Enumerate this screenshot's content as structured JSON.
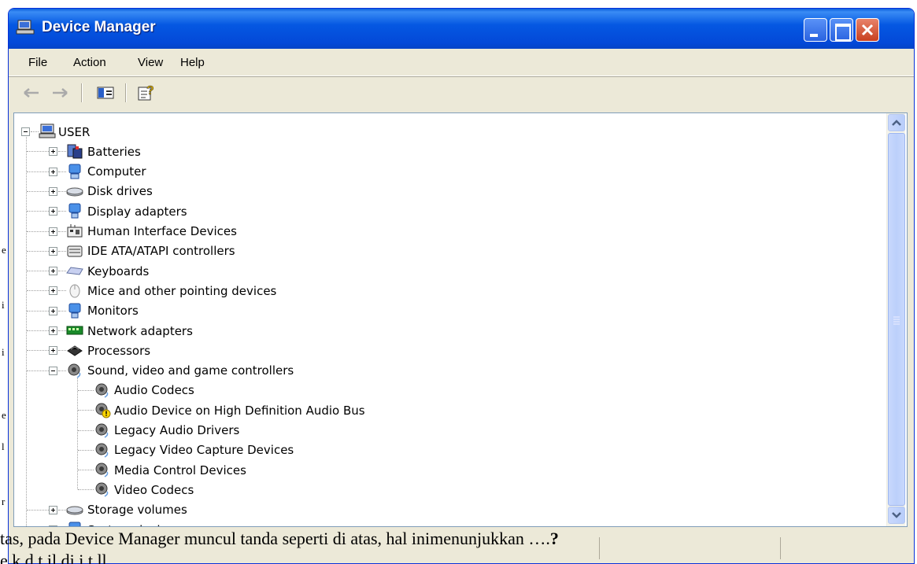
{
  "window": {
    "title": "Device Manager"
  },
  "menu": {
    "file": "File",
    "action": "Action",
    "view": "View",
    "help": "Help"
  },
  "tree": {
    "root": "USER",
    "categories": [
      {
        "label": "Batteries",
        "icon": "battery-icon",
        "expanded": false
      },
      {
        "label": "Computer",
        "icon": "computer-icon",
        "expanded": false
      },
      {
        "label": "Disk drives",
        "icon": "disk-drive-icon",
        "expanded": false
      },
      {
        "label": "Display adapters",
        "icon": "display-adapter-icon",
        "expanded": false
      },
      {
        "label": "Human Interface Devices",
        "icon": "hid-icon",
        "expanded": false
      },
      {
        "label": "IDE ATA/ATAPI controllers",
        "icon": "ide-controller-icon",
        "expanded": false
      },
      {
        "label": "Keyboards",
        "icon": "keyboard-icon",
        "expanded": false
      },
      {
        "label": "Mice and other pointing devices",
        "icon": "mouse-icon",
        "expanded": false
      },
      {
        "label": "Monitors",
        "icon": "monitor-icon",
        "expanded": false
      },
      {
        "label": "Network adapters",
        "icon": "network-adapter-icon",
        "expanded": false
      },
      {
        "label": "Processors",
        "icon": "processor-icon",
        "expanded": false
      },
      {
        "label": "Sound, video and game controllers",
        "icon": "speaker-icon",
        "expanded": true
      },
      {
        "label": "Storage volumes",
        "icon": "storage-volume-icon",
        "expanded": false
      },
      {
        "label": "System devices",
        "icon": "system-device-icon",
        "expanded": false
      }
    ],
    "sound_children": [
      {
        "label": "Audio Codecs",
        "warning": false
      },
      {
        "label": "Audio Device on High Definition Audio Bus",
        "warning": true
      },
      {
        "label": "Legacy Audio Drivers",
        "warning": false
      },
      {
        "label": "Legacy Video Capture Devices",
        "warning": false
      },
      {
        "label": "Media Control Devices",
        "warning": false
      },
      {
        "label": "Video Codecs",
        "warning": false
      }
    ]
  },
  "overlay": {
    "question": "tas, pada Device Manager muncul tanda seperti di atas, hal inimenunjukkan ….",
    "question_mark": "?",
    "answer_partial": "e                  k  d     t  il  di  i  t   ll",
    "left_margin": [
      "e",
      "i",
      "i",
      "e",
      "l",
      "r"
    ]
  },
  "colors": {
    "titlebar": "#0558e2",
    "window": "#ece9d8",
    "warning": "#ffd700"
  }
}
